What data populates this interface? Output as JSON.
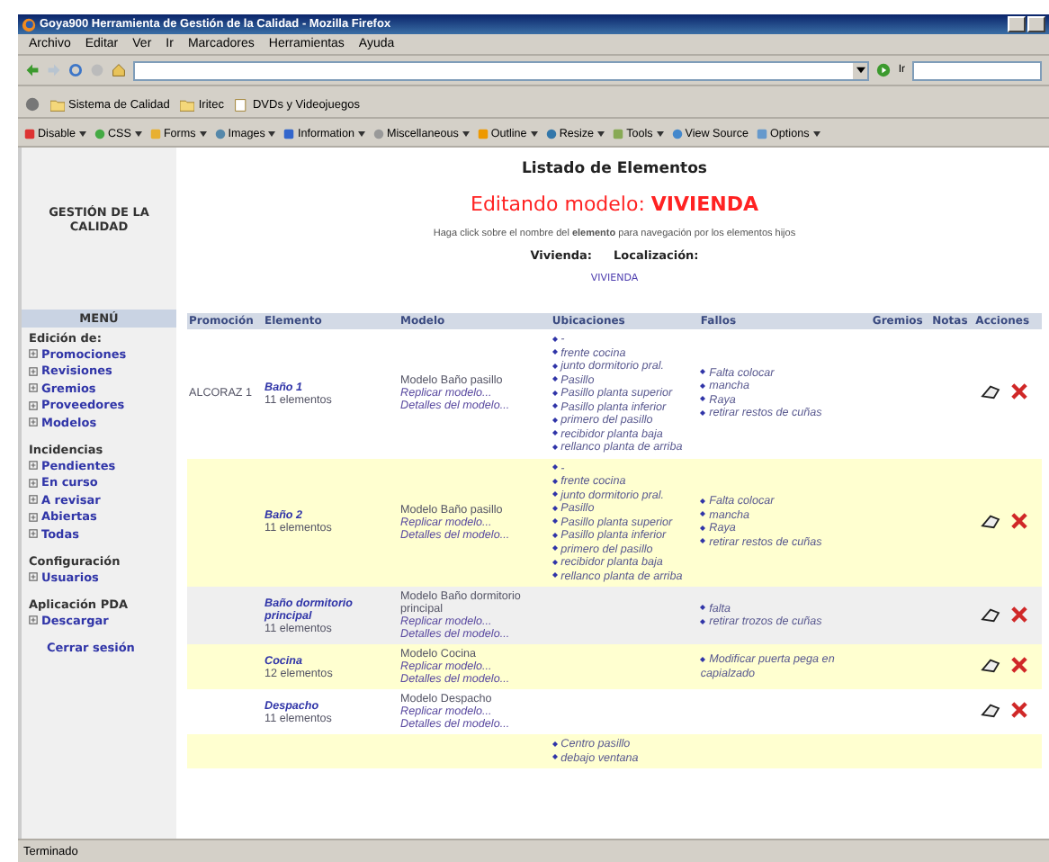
{
  "window": {
    "title": "Goya900 Herramienta de Gestión de la Calidad - Mozilla Firefox"
  },
  "menu": [
    "Archivo",
    "Editar",
    "Ver",
    "Ir",
    "Marcadores",
    "Herramientas",
    "Ayuda"
  ],
  "nav": {
    "go_label": "Ir"
  },
  "bookmarks": [
    "Sistema de Calidad",
    "Iritec",
    "DVDs y Videojuegos"
  ],
  "dev_toolbar": [
    {
      "label": "Disable",
      "dropdown": true
    },
    {
      "label": "CSS",
      "dropdown": true
    },
    {
      "label": "Forms",
      "dropdown": true
    },
    {
      "label": "Images",
      "dropdown": true
    },
    {
      "label": "Information",
      "dropdown": true
    },
    {
      "label": "Miscellaneous",
      "dropdown": true
    },
    {
      "label": "Outline",
      "dropdown": true
    },
    {
      "label": "Resize",
      "dropdown": true
    },
    {
      "label": "Tools",
      "dropdown": true
    },
    {
      "label": "View Source",
      "dropdown": false
    },
    {
      "label": "Options",
      "dropdown": true
    }
  ],
  "sidebar": {
    "logo": "GESTIÓN DE LA CALIDAD",
    "menu_title": "MENÚ",
    "sections": [
      {
        "title": "Edición de:",
        "items": [
          "Promociones",
          "Revisiones",
          "Gremios",
          "Proveedores",
          "Modelos"
        ]
      },
      {
        "title": "Incidencias",
        "items": [
          "Pendientes",
          "En curso",
          "A revisar",
          "Abiertas",
          "Todas"
        ]
      },
      {
        "title": "Configuración",
        "items": [
          "Usuarios"
        ]
      },
      {
        "title": "Aplicación PDA",
        "items": [
          "Descargar"
        ]
      }
    ],
    "logout": "Cerrar sesión"
  },
  "page": {
    "heading": "Listado de Elementos",
    "editing_label": "Editando modelo:",
    "model": "VIVIENDA",
    "hint": "Haga click sobre el nombre del **elemento** para navegación por los elementos hijos",
    "vivienda_label": "Vivienda:",
    "localizacion_label": "Localización:",
    "location_link": "VIVIENDA"
  },
  "table": {
    "columns": [
      "Promoción",
      "Elemento",
      "Modelo",
      "Ubicaciones",
      "Fallos",
      "Gremios",
      "Notas",
      "Acciones"
    ],
    "rows": [
      {
        "promocion": "ALCORAZ 1",
        "element": "Baño 1",
        "count": "11 elementos",
        "model": "Modelo Baño pasillo",
        "model_links": [
          "Replicar modelo...",
          "Detalles del modelo..."
        ],
        "locations": [
          "-",
          "frente cocina",
          "junto dormitorio pral.",
          "Pasillo",
          "Pasillo planta superior",
          "Pasillo planta inferior",
          "primero del pasillo",
          "recibidor planta baja",
          "rellanco planta de arriba"
        ],
        "faults": [
          "Falta colocar",
          "mancha",
          "Raya",
          "retirar restos de cuñas"
        ],
        "selected": false,
        "actions": true
      },
      {
        "element": "Baño 2",
        "count": "11 elementos",
        "model": "Modelo Baño pasillo",
        "model_links": [
          "Replicar modelo...",
          "Detalles del modelo..."
        ],
        "locations": [
          "-",
          "frente cocina",
          "junto dormitorio pral.",
          "Pasillo",
          "Pasillo planta superior",
          "Pasillo planta inferior",
          "primero del pasillo",
          "recibidor planta baja",
          "rellanco planta de arriba"
        ],
        "faults": [
          "Falta colocar",
          "mancha",
          "Raya",
          "retirar restos de cuñas"
        ],
        "selected": false,
        "actions": true
      },
      {
        "element": "Baño dormitorio principal",
        "count": "11 elementos",
        "model": "Modelo Baño dormitorio principal",
        "model_links": [
          "Replicar modelo...",
          "Detalles del modelo..."
        ],
        "faults": [
          "falta",
          "retirar trozos de cuñas"
        ],
        "selected": true,
        "actions": true
      },
      {
        "element": "Cocina",
        "count": "12 elementos",
        "model": "Modelo Cocina",
        "model_links": [
          "Replicar modelo...",
          "Detalles del modelo..."
        ],
        "faults": [
          "Modificar puerta pega en capialzado"
        ],
        "selected": false,
        "actions": true
      },
      {
        "element": "Despacho",
        "count": "11 elementos",
        "model": "Modelo Despacho",
        "model_links": [
          "Replicar modelo...",
          "Detalles del modelo..."
        ],
        "selected": false,
        "actions": true
      },
      {
        "locations": [
          "Centro pasillo",
          "debajo ventana"
        ],
        "selected": false,
        "actions": false
      }
    ]
  },
  "status_bar": "Terminado"
}
